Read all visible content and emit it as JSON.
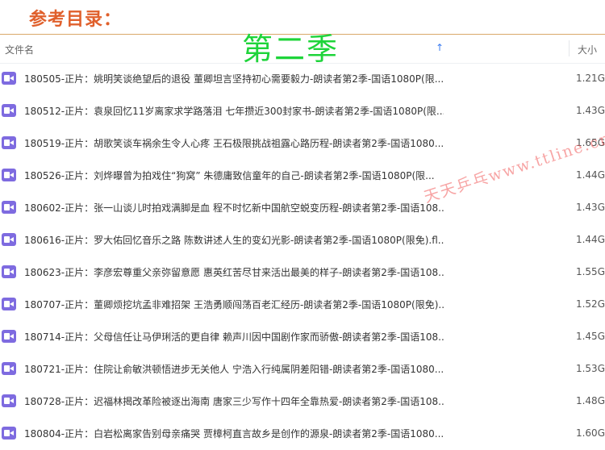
{
  "top_title": "参考目录：",
  "season_overlay": "第二季",
  "header": {
    "name_col": "文件名",
    "size_col": "大小"
  },
  "files": [
    {
      "name": "180505-正片：姚明笑谈绝望后的退役 董卿坦言坚持初心需要毅力-朗读者第2季-国语1080P(限...",
      "size": "1.21G"
    },
    {
      "name": "180512-正片：袁泉回忆11岁离家求学路落泪 七年攒近300封家书-朗读者第2季-国语1080P(限...",
      "size": "1.43G"
    },
    {
      "name": "180519-正片：胡歌笑谈车祸余生令人心疼 王石极限挑战祖露心路历程-朗读者第2季-国语1080...",
      "size": "1.65G"
    },
    {
      "name": "180526-正片：刘烨曝曾为拍戏住“狗窝” 朱德庸致信童年的自己-朗读者第2季-国语1080P(限...",
      "size": "1.44G"
    },
    {
      "name": "180602-正片：张一山谈儿时拍戏满脚是血 程不时忆新中国航空蜕变历程-朗读者第2季-国语108...",
      "size": "1.43G"
    },
    {
      "name": "180616-正片：罗大佑回忆音乐之路 陈数讲述人生的变幻光影-朗读者第2季-国语1080P(限免).fl...",
      "size": "1.44G"
    },
    {
      "name": "180623-正片：李彦宏尊重父亲弥留意愿 惠英红苦尽甘来活出最美的样子-朗读者第2季-国语108...",
      "size": "1.55G"
    },
    {
      "name": "180707-正片：董卿烦挖坑孟非难招架 王浩勇顺闯荡百老汇经历-朗读者第2季-国语1080P(限免)...",
      "size": "1.52G"
    },
    {
      "name": "180714-正片：父母信任让马伊琍活的更自律 赖声川因中国剧作家而骄傲-朗读者第2季-国语108...",
      "size": "1.45G"
    },
    {
      "name": "180721-正片：住院让俞敏洪顿悟进步无关他人 宁浩入行纯属阴差阳错-朗读者第2季-国语1080...",
      "size": "1.53G"
    },
    {
      "name": "180728-正片：迟福林揭改革险被逐出海南 唐家三少写作十四年全靠热爱-朗读者第2季-国语108...",
      "size": "1.48G"
    },
    {
      "name": "180804-正片：白岩松离家告别母亲痛哭 贾樟柯直言故乡是创作的源泉-朗读者第2季-国语1080...",
      "size": "1.60G"
    }
  ],
  "watermark": "天天乒乓www.ttline.cn"
}
